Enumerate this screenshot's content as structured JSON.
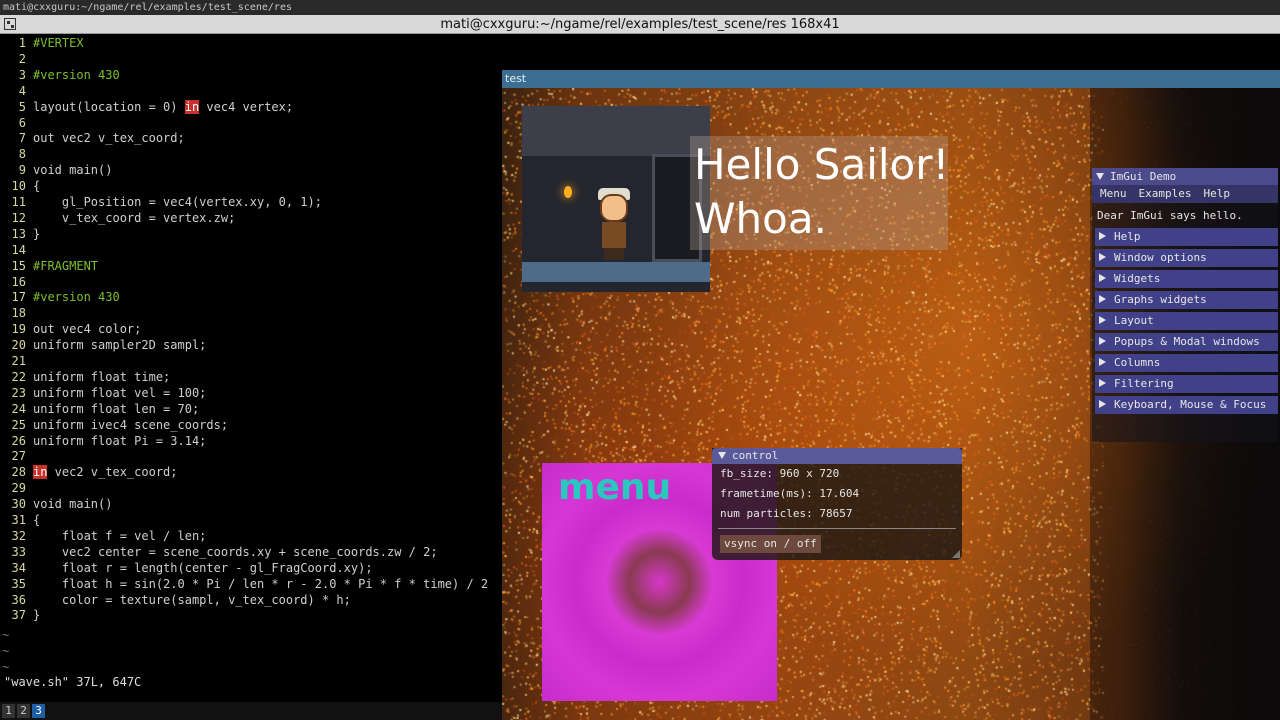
{
  "sysbar": {
    "text": "mati@cxxguru:~/ngame/rel/examples/test_scene/res"
  },
  "terminal": {
    "title": "mati@cxxguru:~/ngame/rel/examples/test_scene/res 168x41"
  },
  "editor": {
    "lines": [
      {
        "n": "1",
        "t": "#VERTEX",
        "cls": "directive"
      },
      {
        "n": "2",
        "t": ""
      },
      {
        "n": "3",
        "t": "#version 430",
        "cls": "directive"
      },
      {
        "n": "4",
        "t": ""
      },
      {
        "n": "5",
        "t": "layout(location = 0) in vec4 vertex;",
        "kw": true
      },
      {
        "n": "6",
        "t": ""
      },
      {
        "n": "7",
        "t": "out vec2 v_tex_coord;"
      },
      {
        "n": "8",
        "t": ""
      },
      {
        "n": "9",
        "t": "void main()"
      },
      {
        "n": "10",
        "t": "{"
      },
      {
        "n": "11",
        "t": "    gl_Position = vec4(vertex.xy, 0, 1);"
      },
      {
        "n": "12",
        "t": "    v_tex_coord = vertex.zw;"
      },
      {
        "n": "13",
        "t": "}"
      },
      {
        "n": "14",
        "t": ""
      },
      {
        "n": "15",
        "t": "#FRAGMENT",
        "cls": "directive"
      },
      {
        "n": "16",
        "t": ""
      },
      {
        "n": "17",
        "t": "#version 430",
        "cls": "directive"
      },
      {
        "n": "18",
        "t": ""
      },
      {
        "n": "19",
        "t": "out vec4 color;"
      },
      {
        "n": "20",
        "t": "uniform sampler2D sampl;"
      },
      {
        "n": "21",
        "t": ""
      },
      {
        "n": "22",
        "t": "uniform float time;"
      },
      {
        "n": "23",
        "t": "uniform float vel = 100;"
      },
      {
        "n": "24",
        "t": "uniform float len = 70;"
      },
      {
        "n": "25",
        "t": "uniform ivec4 scene_coords;"
      },
      {
        "n": "26",
        "t": "uniform float Pi = 3.14;"
      },
      {
        "n": "27",
        "t": ""
      },
      {
        "n": "28",
        "t": "in vec2 v_tex_coord;",
        "kw": true
      },
      {
        "n": "29",
        "t": ""
      },
      {
        "n": "30",
        "t": "void main()"
      },
      {
        "n": "31",
        "t": "{"
      },
      {
        "n": "32",
        "t": "    float f = vel / len;"
      },
      {
        "n": "33",
        "t": "    vec2 center = scene_coords.xy + scene_coords.zw / 2;"
      },
      {
        "n": "34",
        "t": "    float r = length(center - gl_FragCoord.xy);"
      },
      {
        "n": "35",
        "t": "    float h = sin(2.0 * Pi / len * r - 2.0 * Pi * f * time) / 2"
      },
      {
        "n": "36",
        "t": "    color = texture(sampl, v_tex_coord) * h;"
      },
      {
        "n": "37",
        "t": "}"
      }
    ],
    "tilde": "~",
    "status": "\"wave.sh\" 37L, 647C"
  },
  "tabs": [
    "1",
    "2",
    "3"
  ],
  "active_tab": "3",
  "game": {
    "title": "test",
    "hello_text": "Hello Sailor!\nWhoa.",
    "menu_text": "menu"
  },
  "imgui_demo": {
    "title": "ImGui Demo",
    "menus": [
      "Menu",
      "Examples",
      "Help"
    ],
    "hello": "Dear ImGui says hello.",
    "headers": [
      "Help",
      "Window options",
      "Widgets",
      "Graphs widgets",
      "Layout",
      "Popups & Modal windows",
      "Columns",
      "Filtering",
      "Keyboard, Mouse & Focus"
    ]
  },
  "control": {
    "title": "control",
    "fb_size": "fb_size: 960 x 720",
    "frametime": "frametime(ms): 17.604",
    "particles": "num particles: 78657",
    "vsync_button": "vsync on / off"
  },
  "colors": {
    "directive": "#7fbf2a",
    "keyword_bg": "#c8302c",
    "active_tab": "#1f5fa8",
    "imgui_header": "#41418a"
  }
}
